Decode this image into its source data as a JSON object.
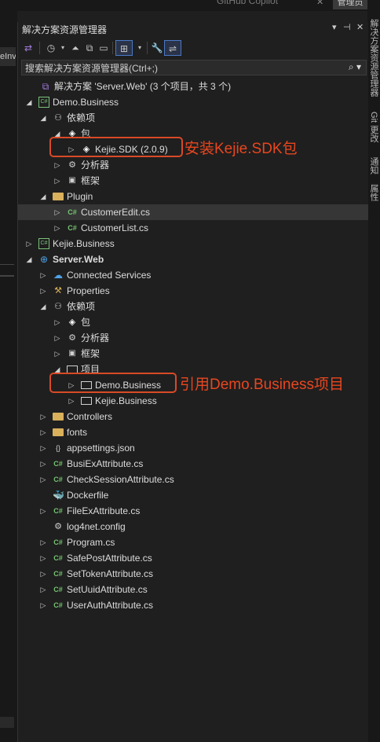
{
  "top": {
    "copilot": "GitHub Copilot",
    "button": "管理员"
  },
  "left_tab": "eInv",
  "right_tabs": [
    "解决方案资源管理器",
    "Git 更改",
    "通知",
    "属性"
  ],
  "panel": {
    "title": "解决方案资源管理器",
    "controls": [
      "▾",
      "⊣",
      "✕"
    ],
    "search_placeholder": "搜索解决方案资源管理器(Ctrl+;)"
  },
  "tree": [
    {
      "label": "解决方案 'Server.Web' (3 个项目，共 3 个)",
      "icon": "solution-icon",
      "depth": 0,
      "exp": ""
    },
    {
      "label": "Demo.Business",
      "icon": "csharp-project-icon",
      "depth": 0,
      "exp": "open"
    },
    {
      "label": "依赖项",
      "icon": "dependencies-icon",
      "depth": 1,
      "exp": "open"
    },
    {
      "label": "包",
      "icon": "package-icon",
      "depth": 2,
      "exp": "open"
    },
    {
      "label": "Kejie.SDK (2.0.9)",
      "icon": "package-icon",
      "depth": 3,
      "exp": "closed"
    },
    {
      "label": "分析器",
      "icon": "analyzer-icon",
      "depth": 2,
      "exp": "closed"
    },
    {
      "label": "框架",
      "icon": "framework-icon",
      "depth": 2,
      "exp": "closed"
    },
    {
      "label": "Plugin",
      "icon": "folder-icon",
      "depth": 1,
      "exp": "open"
    },
    {
      "label": "CustomerEdit.cs",
      "icon": "csharp-file-icon",
      "depth": 2,
      "exp": "closed",
      "selected": true
    },
    {
      "label": "CustomerList.cs",
      "icon": "csharp-file-icon",
      "depth": 2,
      "exp": "closed"
    },
    {
      "label": "Kejie.Business",
      "icon": "csharp-project-icon",
      "depth": 0,
      "exp": "closed"
    },
    {
      "label": "Server.Web",
      "icon": "web-project-icon",
      "depth": 0,
      "exp": "open",
      "bold": true
    },
    {
      "label": "Connected Services",
      "icon": "connected-services-icon",
      "depth": 1,
      "exp": "closed"
    },
    {
      "label": "Properties",
      "icon": "properties-icon",
      "depth": 1,
      "exp": "closed"
    },
    {
      "label": "依赖项",
      "icon": "dependencies-icon",
      "depth": 1,
      "exp": "open"
    },
    {
      "label": "包",
      "icon": "package-icon",
      "depth": 2,
      "exp": "closed"
    },
    {
      "label": "分析器",
      "icon": "analyzer-icon",
      "depth": 2,
      "exp": "closed"
    },
    {
      "label": "框架",
      "icon": "framework-icon",
      "depth": 2,
      "exp": "closed"
    },
    {
      "label": "项目",
      "icon": "project-ref-icon",
      "depth": 2,
      "exp": "open"
    },
    {
      "label": "Demo.Business",
      "icon": "project-ref-icon",
      "depth": 3,
      "exp": "closed"
    },
    {
      "label": "Kejie.Business",
      "icon": "project-ref-icon",
      "depth": 3,
      "exp": "closed"
    },
    {
      "label": "Controllers",
      "icon": "folder-icon",
      "depth": 1,
      "exp": "closed"
    },
    {
      "label": "fonts",
      "icon": "folder-icon",
      "depth": 1,
      "exp": "closed"
    },
    {
      "label": "appsettings.json",
      "icon": "json-file-icon",
      "depth": 1,
      "exp": "closed"
    },
    {
      "label": "BusiExAttribute.cs",
      "icon": "csharp-file-icon",
      "depth": 1,
      "exp": "closed"
    },
    {
      "label": "CheckSessionAttribute.cs",
      "icon": "csharp-file-icon",
      "depth": 1,
      "exp": "closed"
    },
    {
      "label": "Dockerfile",
      "icon": "docker-icon",
      "depth": 1,
      "exp": ""
    },
    {
      "label": "FileExAttribute.cs",
      "icon": "csharp-file-icon",
      "depth": 1,
      "exp": "closed"
    },
    {
      "label": "log4net.config",
      "icon": "config-file-icon",
      "depth": 1,
      "exp": ""
    },
    {
      "label": "Program.cs",
      "icon": "csharp-file-icon",
      "depth": 1,
      "exp": "closed"
    },
    {
      "label": "SafePostAttribute.cs",
      "icon": "csharp-file-icon",
      "depth": 1,
      "exp": "closed"
    },
    {
      "label": "SetTokenAttribute.cs",
      "icon": "csharp-file-icon",
      "depth": 1,
      "exp": "closed"
    },
    {
      "label": "SetUuidAttribute.cs",
      "icon": "csharp-file-icon",
      "depth": 1,
      "exp": "closed"
    },
    {
      "label": "UserAuthAttribute.cs",
      "icon": "csharp-file-icon",
      "depth": 1,
      "exp": "closed"
    }
  ],
  "annotations": [
    {
      "text": "安装Kejie.SDK包",
      "row": 4
    },
    {
      "text": "引用Demo.Business项目",
      "row": 19
    }
  ],
  "colors": {
    "background": "#1f1f1f",
    "annotation": "#e8461f",
    "selected_row": "#363636"
  }
}
